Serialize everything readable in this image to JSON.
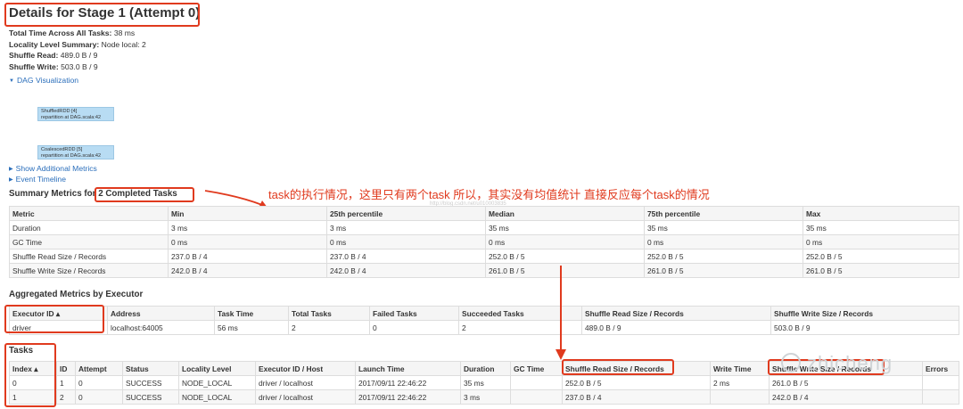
{
  "title": "Details for Stage 1 (Attempt 0)",
  "stats": [
    {
      "label": "Total Time Across All Tasks:",
      "value": "38 ms"
    },
    {
      "label": "Locality Level Summary:",
      "value": "Node local: 2"
    },
    {
      "label": "Shuffle Read:",
      "value": "489.0 B / 9"
    },
    {
      "label": "Shuffle Write:",
      "value": "503.0 B / 9"
    }
  ],
  "dag_toggle": "DAG Visualization",
  "dag_nodes": [
    {
      "name": "ShuffledRDD [4]",
      "call": "repartition at DAG.scala:42"
    },
    {
      "name": "CoalescedRDD [5]",
      "call": "repartition at DAG.scala:42"
    }
  ],
  "show_metrics": "Show Additional Metrics",
  "event_timeline": "Event Timeline",
  "summary_metrics": {
    "heading_prefix": "Summary Metrics for ",
    "heading_count": "2 Completed Tasks",
    "headers": [
      "Metric",
      "Min",
      "25th percentile",
      "Median",
      "75th percentile",
      "Max"
    ],
    "rows": [
      [
        "Duration",
        "3 ms",
        "3 ms",
        "35 ms",
        "35 ms",
        "35 ms"
      ],
      [
        "GC Time",
        "0 ms",
        "0 ms",
        "0 ms",
        "0 ms",
        "0 ms"
      ],
      [
        "Shuffle Read Size / Records",
        "237.0 B / 4",
        "237.0 B / 4",
        "252.0 B / 5",
        "252.0 B / 5",
        "252.0 B / 5"
      ],
      [
        "Shuffle Write Size / Records",
        "242.0 B / 4",
        "242.0 B / 4",
        "261.0 B / 5",
        "261.0 B / 5",
        "261.0 B / 5"
      ]
    ]
  },
  "annotation": "task的执行情况，这里只有两个task 所以，其实没有均值统计 直接反应每个task的情况",
  "watermark_small": "http://blog.csdn.net/u010003835",
  "watermark_big": "zhicheng",
  "executors": {
    "heading": "Aggregated Metrics by Executor",
    "headers": [
      "Executor ID ▴",
      "Address",
      "Task Time",
      "Total Tasks",
      "Failed Tasks",
      "Succeeded Tasks",
      "Shuffle Read Size / Records",
      "Shuffle Write Size / Records"
    ],
    "rows": [
      [
        "driver",
        "localhost:64005",
        "56 ms",
        "2",
        "0",
        "2",
        "489.0 B / 9",
        "503.0 B / 9"
      ]
    ]
  },
  "tasks": {
    "heading": "Tasks",
    "headers": [
      "Index ▴",
      "ID",
      "Attempt",
      "Status",
      "Locality Level",
      "Executor ID / Host",
      "Launch Time",
      "Duration",
      "GC Time",
      "Shuffle Read Size / Records",
      "Write Time",
      "Shuffle Write Size / Records",
      "Errors"
    ],
    "rows": [
      [
        "0",
        "1",
        "0",
        "SUCCESS",
        "NODE_LOCAL",
        "driver / localhost",
        "2017/09/11 22:46:22",
        "35 ms",
        "",
        "252.0 B / 5",
        "2 ms",
        "261.0 B / 5",
        ""
      ],
      [
        "1",
        "2",
        "0",
        "SUCCESS",
        "NODE_LOCAL",
        "driver / localhost",
        "2017/09/11 22:46:22",
        "3 ms",
        "",
        "237.0 B / 4",
        "",
        "242.0 B / 4",
        ""
      ]
    ]
  },
  "colors": {
    "link": "#2a6ebb",
    "annotation": "#e03a1e",
    "dag_node": "#b8dcf3"
  }
}
